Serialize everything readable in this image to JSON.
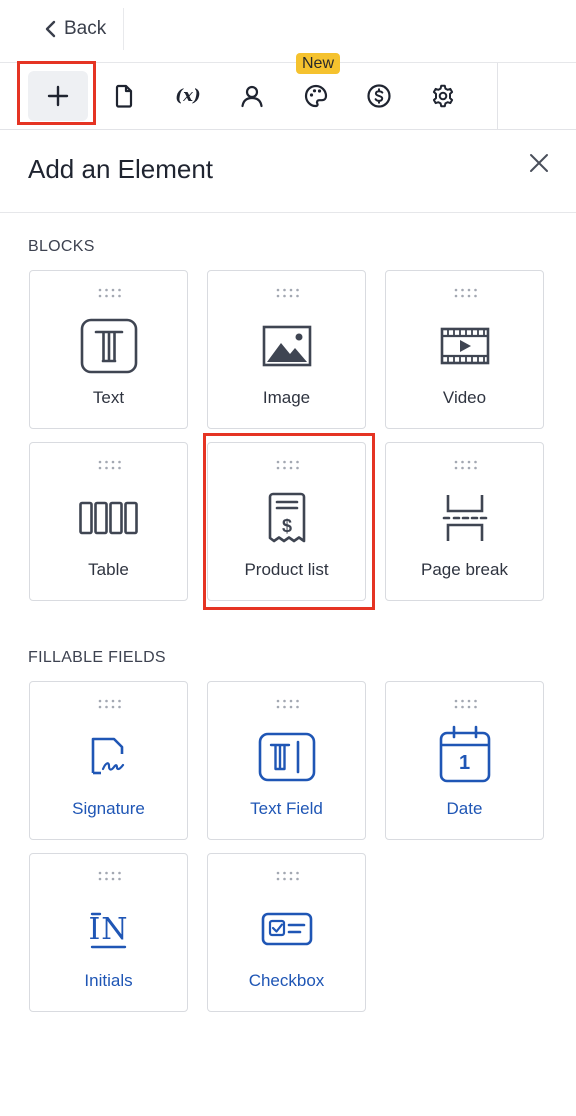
{
  "header": {
    "back_label": "Back"
  },
  "toolbar": {
    "badge_new": "New",
    "tools": [
      {
        "name": "plus-icon"
      },
      {
        "name": "document-icon"
      },
      {
        "name": "variable-icon"
      },
      {
        "name": "user-icon"
      },
      {
        "name": "palette-icon"
      },
      {
        "name": "dollar-icon"
      },
      {
        "name": "gear-icon"
      }
    ]
  },
  "panel": {
    "title": "Add an Element"
  },
  "blocks": {
    "heading": "BLOCKS",
    "items": [
      {
        "label": "Text",
        "icon": "text-block-icon"
      },
      {
        "label": "Image",
        "icon": "image-icon"
      },
      {
        "label": "Video",
        "icon": "video-icon"
      },
      {
        "label": "Table",
        "icon": "table-icon"
      },
      {
        "label": "Product list",
        "icon": "receipt-dollar-icon"
      },
      {
        "label": "Page break",
        "icon": "page-break-icon"
      }
    ]
  },
  "fields": {
    "heading": "FILLABLE FIELDS",
    "items": [
      {
        "label": "Signature",
        "icon": "signature-icon"
      },
      {
        "label": "Text Field",
        "icon": "text-field-icon"
      },
      {
        "label": "Date",
        "icon": "calendar-icon",
        "glyph": "1"
      },
      {
        "label": "Initials",
        "icon": "initials-icon",
        "glyph": "IN"
      },
      {
        "label": "Checkbox",
        "icon": "checkbox-icon"
      }
    ]
  },
  "colors": {
    "highlight": "#e53423",
    "field_blue": "#1f56b5",
    "badge": "#f5c22e",
    "icon_gray": "#3f4552"
  }
}
